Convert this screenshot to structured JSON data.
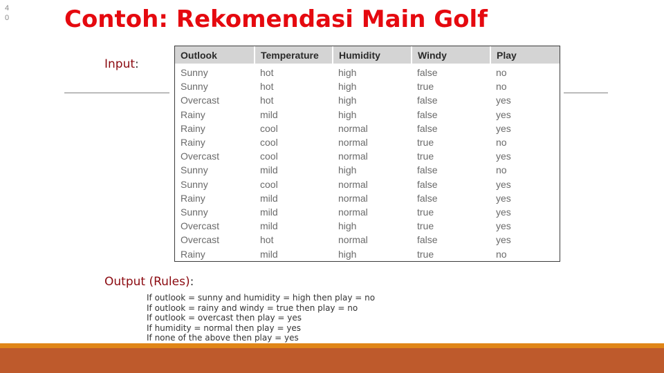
{
  "slide": {
    "number_digits": [
      "4",
      "0"
    ],
    "title": "Contoh: Rekomendasi Main Golf",
    "input_label": "Input",
    "output_label_main": "Output",
    "output_label_paren": "(Rules)",
    "label_colon": ":"
  },
  "table": {
    "headers": [
      "Outlook",
      "Temperature",
      "Humidity",
      "Windy",
      "Play"
    ],
    "rows": [
      [
        "Sunny",
        "hot",
        "high",
        "false",
        "no"
      ],
      [
        "Sunny",
        "hot",
        "high",
        "true",
        "no"
      ],
      [
        "Overcast",
        "hot",
        "high",
        "false",
        "yes"
      ],
      [
        "Rainy",
        "mild",
        "high",
        "false",
        "yes"
      ],
      [
        "Rainy",
        "cool",
        "normal",
        "false",
        "yes"
      ],
      [
        "Rainy",
        "cool",
        "normal",
        "true",
        "no"
      ],
      [
        "Overcast",
        "cool",
        "normal",
        "true",
        "yes"
      ],
      [
        "Sunny",
        "mild",
        "high",
        "false",
        "no"
      ],
      [
        "Sunny",
        "cool",
        "normal",
        "false",
        "yes"
      ],
      [
        "Rainy",
        "mild",
        "normal",
        "false",
        "yes"
      ],
      [
        "Sunny",
        "mild",
        "normal",
        "true",
        "yes"
      ],
      [
        "Overcast",
        "mild",
        "high",
        "true",
        "yes"
      ],
      [
        "Overcast",
        "hot",
        "normal",
        "false",
        "yes"
      ],
      [
        "Rainy",
        "mild",
        "high",
        "true",
        "no"
      ]
    ]
  },
  "rules": [
    "If outlook = sunny and humidity = high then play = no",
    "If outlook = rainy and windy = true then play = no",
    "If outlook = overcast then play = yes",
    "If humidity = normal then play = yes",
    "If none of the above then play = yes"
  ],
  "colors": {
    "title": "#e5090f",
    "label": "#8b0a10",
    "footer_accent": "#e08618",
    "footer": "#be5a2c"
  }
}
